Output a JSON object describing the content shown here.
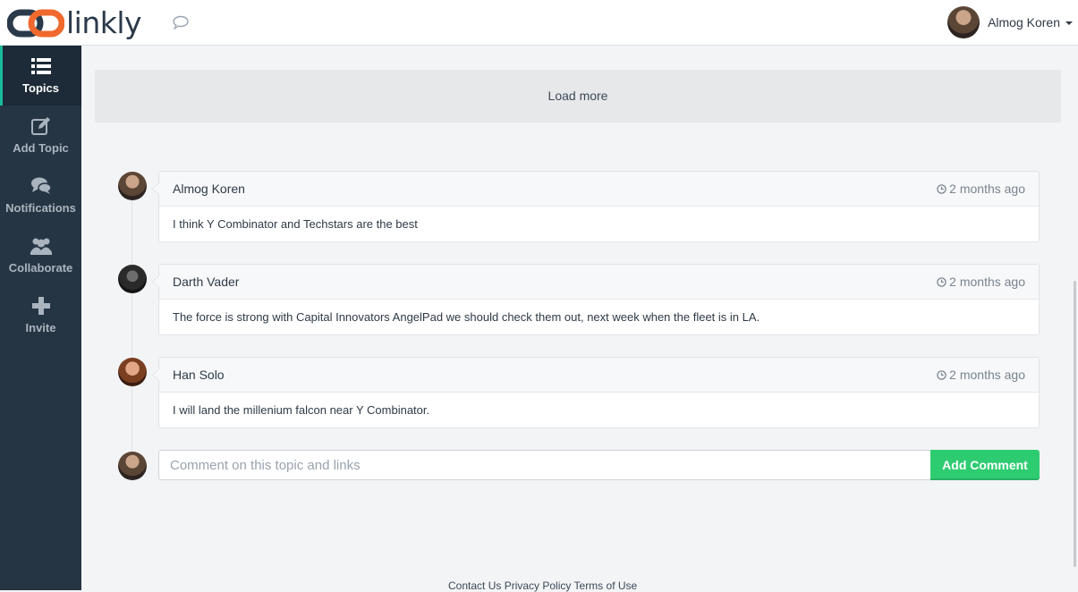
{
  "brand": {
    "name": "linkly"
  },
  "header": {
    "chat_icon": "speech-bubble-icon",
    "user": {
      "name": "Almog Koren",
      "avatar": "user-avatar"
    }
  },
  "sidebar": {
    "items": [
      {
        "label": "Topics",
        "icon": "list-icon",
        "active": true
      },
      {
        "label": "Add Topic",
        "icon": "edit-icon",
        "active": false
      },
      {
        "label": "Notifications",
        "icon": "comments-icon",
        "active": false
      },
      {
        "label": "Collaborate",
        "icon": "group-icon",
        "active": false
      },
      {
        "label": "Invite",
        "icon": "plus-icon",
        "active": false
      }
    ]
  },
  "main": {
    "load_more_label": "Load more",
    "comments": [
      {
        "author": "Almog Koren",
        "time": "2 months ago",
        "text": "I think Y Combinator and Techstars are the best"
      },
      {
        "author": "Darth Vader",
        "time": "2 months ago",
        "text": "The force is strong with Capital Innovators AngelPad we should check them out, next week when the fleet is in LA."
      },
      {
        "author": "Han Solo",
        "time": "2 months ago",
        "text": "I will land the millenium falcon near Y Combinator."
      }
    ],
    "composer": {
      "placeholder": "Comment on this topic and links",
      "value": "",
      "button_label": "Add Comment"
    }
  },
  "footer": {
    "links": [
      "Contact Us",
      "Privacy Policy",
      "Terms of Use"
    ]
  },
  "colors": {
    "sidebar_bg": "#263544",
    "accent_green": "#2ecc71",
    "active_marker": "#1abc9c",
    "logo_orange": "#f0692e",
    "logo_navy": "#2b3a4a"
  }
}
